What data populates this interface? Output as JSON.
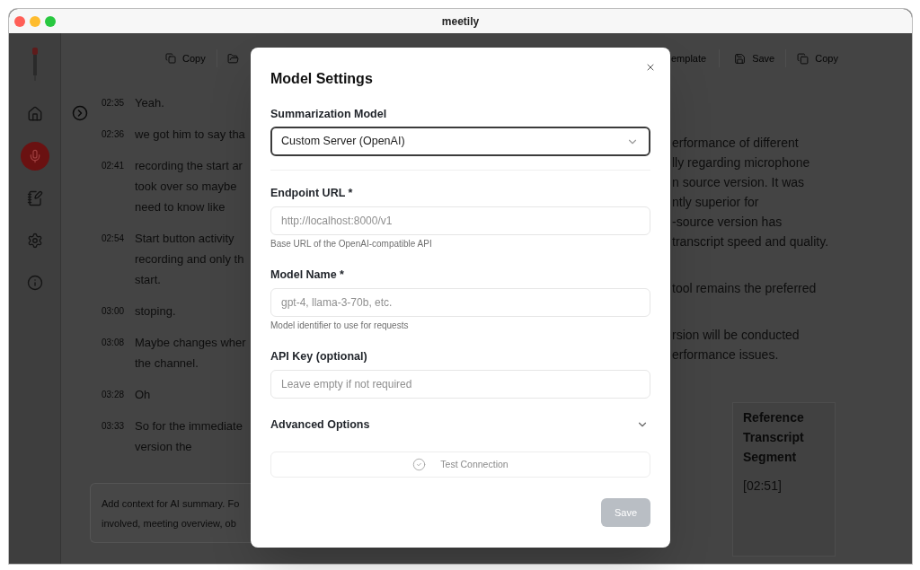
{
  "window": {
    "title": "meetily"
  },
  "transcript_toolbar": {
    "buttons": [
      "Copy"
    ]
  },
  "transcript": [
    {
      "time": "02:35",
      "lines": [
        "Yeah."
      ]
    },
    {
      "time": "02:36",
      "lines": [
        "we got him to say tha"
      ]
    },
    {
      "time": "02:41",
      "lines": [
        "recording the start ar",
        "took over so maybe",
        "need to know like"
      ]
    },
    {
      "time": "02:54",
      "lines": [
        "Start button activity",
        "recording and only th",
        "start."
      ]
    },
    {
      "time": "03:00",
      "lines": [
        "stoping."
      ]
    },
    {
      "time": "03:08",
      "lines": [
        "Maybe changes wher",
        "the channel."
      ]
    },
    {
      "time": "03:28",
      "lines": [
        "Oh"
      ]
    },
    {
      "time": "03:33",
      "lines": [
        "So for the immediate",
        "version the"
      ]
    }
  ],
  "context_field": {
    "placeholder": [
      "Add context for AI summary. Fo",
      "involved, meeting overview, ob"
    ]
  },
  "summary_toolbar": {
    "buttons": [
      "emplate",
      "Save",
      "Copy"
    ]
  },
  "summary": {
    "paragraphs": [
      {
        "lines": [
          "erformance of different",
          "lly regarding microphone",
          "n source version. It was",
          "ntly superior for",
          "-source version has",
          "transcript speed and quality."
        ]
      },
      {
        "lines": [
          "tool remains the preferred"
        ]
      },
      {
        "lines": [
          "rsion will be conducted",
          "erformance issues."
        ]
      }
    ],
    "table": {
      "columns": [
        "Reference Transcript Segment"
      ],
      "rows": [
        [
          "[02:51]"
        ]
      ]
    }
  },
  "dialog": {
    "title": "Model Settings",
    "fields": [
      {
        "kind": "select",
        "label": "Summarization Model",
        "value": "Custom Server (OpenAI)",
        "focused": true
      },
      {
        "kind": "input",
        "label": "Endpoint URL *",
        "placeholder": "http://localhost:8000/v1",
        "hint": "Base URL of the OpenAI-compatible API"
      },
      {
        "kind": "input",
        "label": "Model Name *",
        "placeholder": "gpt-4, llama-3-70b, etc.",
        "hint": "Model identifier to use for requests"
      },
      {
        "kind": "input",
        "label": "API Key (optional)",
        "placeholder": "Leave empty if not required"
      }
    ],
    "advanced_options": {
      "label": "Advanced Options",
      "expanded": false
    },
    "test_button": {
      "label": "Test Connection",
      "disabled": true
    },
    "save_button": {
      "label": "Save",
      "disabled": true
    }
  }
}
